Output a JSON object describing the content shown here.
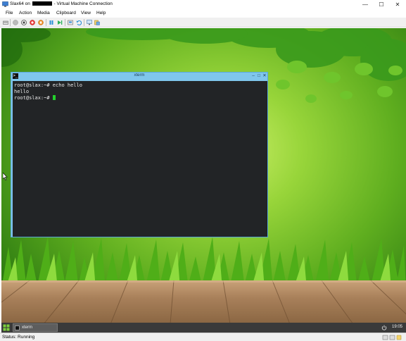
{
  "window": {
    "title_prefix": "Slax64 on",
    "title_suffix": "- Virtual Machine Connection",
    "controls": {
      "minimize": "—",
      "maximize": "☐",
      "close": "✕"
    }
  },
  "menu": {
    "items": [
      "File",
      "Action",
      "Media",
      "Clipboard",
      "View",
      "Help"
    ]
  },
  "toolbar": {
    "icons": [
      "ctrl-alt-del-icon",
      "start-icon",
      "turn-off-icon",
      "shut-down-icon",
      "save-icon",
      "pause-icon",
      "reset-icon",
      "checkpoint-icon",
      "revert-icon",
      "enhanced-session-icon",
      "share-icon"
    ]
  },
  "xterm": {
    "title": "xterm",
    "icon_glyph": ">_",
    "controls": {
      "minimize": "–",
      "maximize": "□",
      "close": "✕"
    },
    "lines": [
      {
        "prompt": "root@slax:~# ",
        "command": "echo hello"
      },
      {
        "output": "hello"
      },
      {
        "prompt": "root@slax:~# ",
        "command": ""
      }
    ]
  },
  "taskbar": {
    "task_label": "xterm",
    "clock": "19:05"
  },
  "status": {
    "text": "Status: Running"
  },
  "colors": {
    "terminal_bg": "#222426",
    "cursor": "#23d12c",
    "xterm_frame": "#7fc6ec",
    "taskbar": "#3a3a3a"
  }
}
